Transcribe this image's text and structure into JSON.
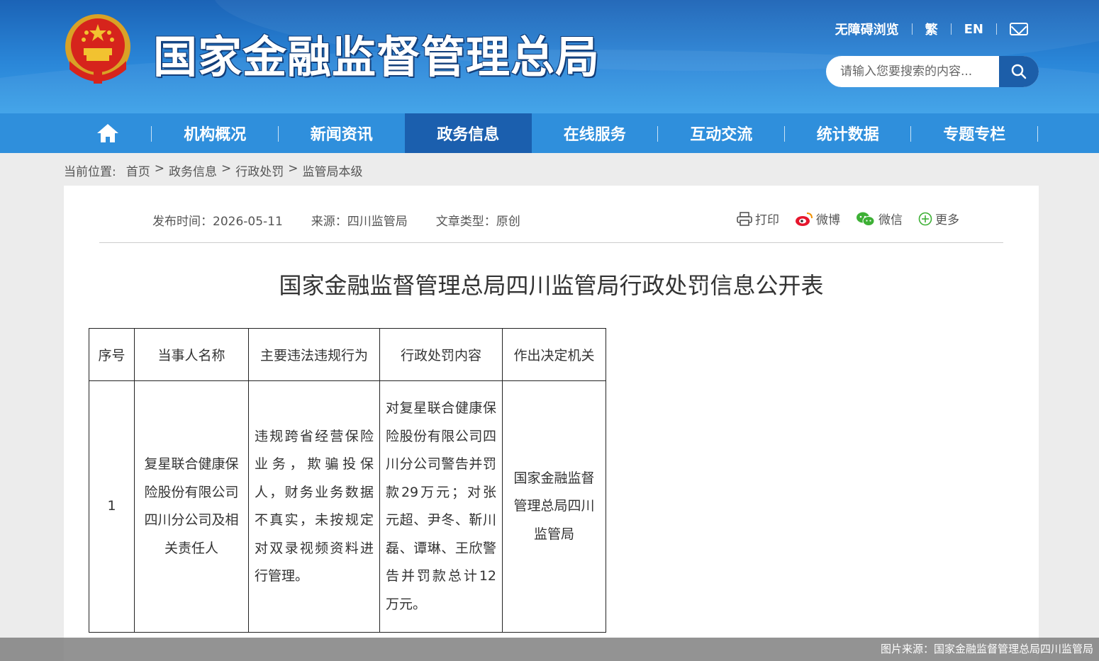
{
  "header": {
    "site_title": "国家金融监督管理总局",
    "links": {
      "accessible": "无障碍浏览",
      "traditional": "繁",
      "english": "EN"
    },
    "search_placeholder": "请输入您要搜索的内容..."
  },
  "nav": {
    "items": [
      "机构概况",
      "新闻资讯",
      "政务信息",
      "在线服务",
      "互动交流",
      "统计数据",
      "专题专栏"
    ],
    "active": "政务信息"
  },
  "breadcrumb": {
    "label": "当前位置:",
    "items": [
      "首页",
      "政务信息",
      "行政处罚",
      "监管局本级"
    ],
    "separator": ">"
  },
  "meta": {
    "publish": "发布时间：2026-05-11",
    "source": "来源：四川监管局",
    "type": "文章类型：原创"
  },
  "share": {
    "print": "打印",
    "weibo": "微博",
    "wechat": "微信",
    "more": "更多"
  },
  "article": {
    "title": "国家金融监督管理总局四川监管局行政处罚信息公开表"
  },
  "table": {
    "headers": [
      "序号",
      "当事人名称",
      "主要违法违规行为",
      "行政处罚内容",
      "作出决定机关"
    ],
    "rows": [
      [
        "1",
        "复星联合健康保险股份有限公司四川分公司及相关责任人",
        "违规跨省经营保险业务，欺骗投保人，财务业务数据不真实，未按规定对双录视频资料进行管理。",
        "对复星联合健康保险股份有限公司四川分公司警告并罚款29万元；对张元超、尹冬、靳川磊、谭琳、王欣警告并罚款总计12万元。",
        "国家金融监督管理总局四川监管局"
      ]
    ]
  },
  "credit": "图片来源：国家金融监督管理总局四川监管局",
  "colors": {
    "header_blue": "#2a86d8",
    "nav_blue": "#2f8fdc",
    "nav_active": "#1b5fae"
  }
}
